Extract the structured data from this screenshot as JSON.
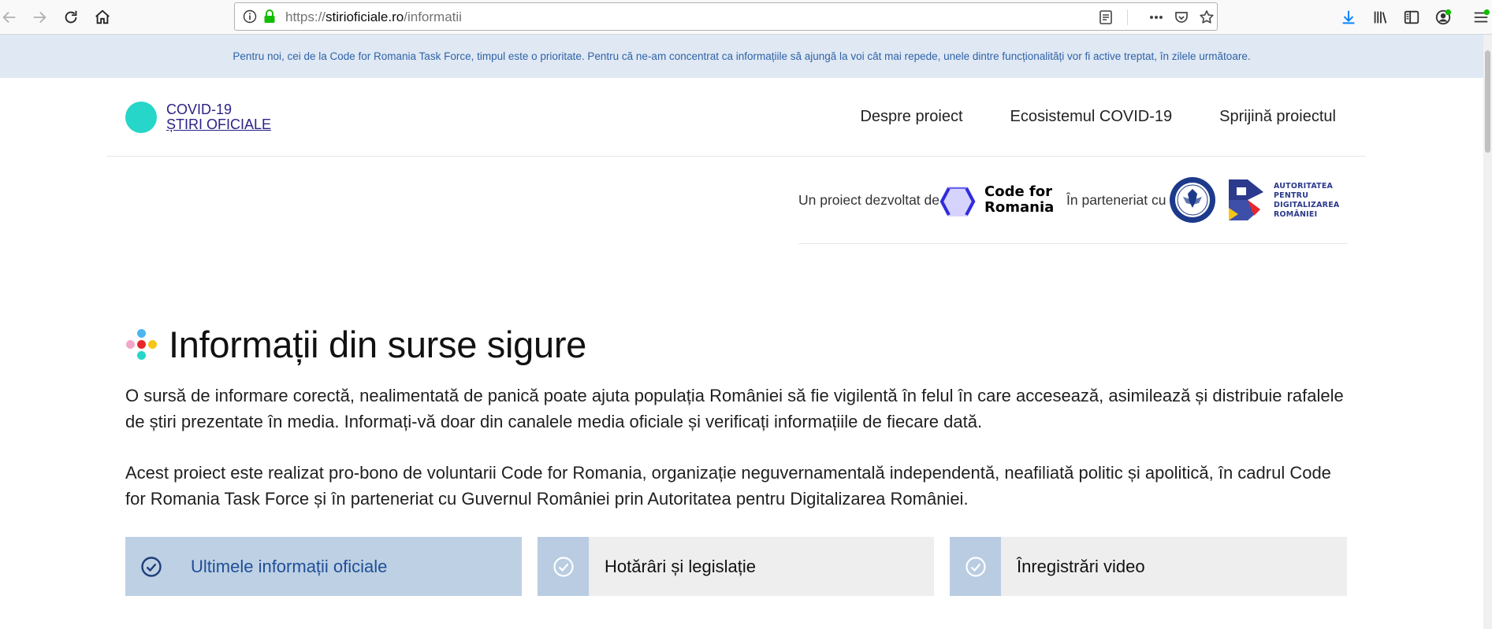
{
  "browser": {
    "url_prefix": "https://",
    "url_domain": "stirioficiale.ro",
    "url_path": "/informatii",
    "icons": [
      "back-icon",
      "forward-icon",
      "reload-icon",
      "home-icon",
      "info-icon",
      "lock-icon",
      "reader-view-icon",
      "more-actions-icon",
      "pocket-icon",
      "bookmark-star-icon",
      "download-icon",
      "library-icon",
      "sidebar-icon",
      "account-icon",
      "menu-icon"
    ]
  },
  "notice": {
    "text": "Pentru noi, cei de la Code for Romania Task Force, timpul este o prioritate. Pentru că ne-am concentrat ca informațiile să ajungă la voi cât mai repede, unele dintre funcționalități vor fi active treptat, în zilele următoare."
  },
  "header": {
    "logo_line1": "COVID-19",
    "logo_line2": "ȘTIRI OFICIALE",
    "nav": [
      {
        "label": "Despre proiect"
      },
      {
        "label": "Ecosistemul COVID-19"
      },
      {
        "label": "Sprijină proiectul"
      }
    ]
  },
  "partners": {
    "developed_by_label": "Un proiect dezvoltat de",
    "cfr_line1": "Code for",
    "cfr_line2": "Romania",
    "partnership_label": "În parteneriat cu",
    "gov_seal_text": "GUVERNUL ROMÂNIEI",
    "adr_line1": "AUTORITATEA",
    "adr_line2": "PENTRU",
    "adr_line3": "DIGITALIZAREA",
    "adr_line4": "ROMÂNIEI"
  },
  "main": {
    "title": "Informații din surse sigure",
    "paragraph1": "O sursă de informare corectă, nealimentată de panică poate ajuta populația României să fie vigilentă în felul în care accesează, asimilează și distribuie rafalele de știri prezentate în media. Informați-vă doar din canalele media oficiale și verificați informațiile de fiecare dată.",
    "paragraph2": "Acest proiect este realizat pro-bono de voluntarii Code for Romania, organizație neguvernamentală independentă, neafiliată politic și apolitică, în cadrul Code for Romania Task Force și în parteneriat cu Guvernul României prin Autoritatea pentru Digitalizarea României.",
    "tabs": [
      {
        "label": "Ultimele informații oficiale",
        "active": true
      },
      {
        "label": "Hotărâri și legislație",
        "active": false
      },
      {
        "label": "Înregistrări video",
        "active": false
      }
    ]
  },
  "colors": {
    "logo_dot": "#25d6c9",
    "logo_text": "#2b2287",
    "notice_bg": "#dfe8f3",
    "notice_text": "#3063a8",
    "tab_active_bg": "#bed0e4",
    "tab_check_bg": "#b9cce2",
    "tab_bg": "#eeeeee"
  }
}
